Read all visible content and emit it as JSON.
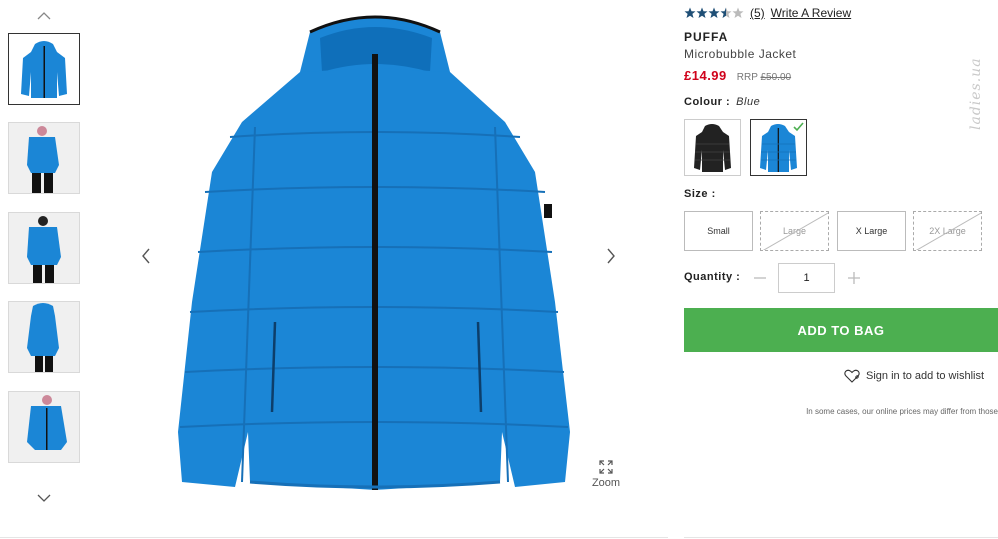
{
  "gallery": {
    "up_icon": "chevron-up-icon",
    "down_icon": "chevron-down-icon",
    "zoom_label": "Zoom"
  },
  "product": {
    "rating": 3.5,
    "review_count": "(5)",
    "write_review": "Write A Review",
    "brand": "PUFFA",
    "name": "Microbubble Jacket",
    "price": "£14.99",
    "rrp_label": "RRP",
    "rrp_value": "£50.00"
  },
  "colour": {
    "label": "Colour :",
    "selected": "Blue",
    "swatches": [
      "black",
      "blue"
    ]
  },
  "size": {
    "label": "Size :",
    "options": [
      {
        "label": "Small",
        "available": true
      },
      {
        "label": "Large",
        "available": false
      },
      {
        "label": "X Large",
        "available": true
      },
      {
        "label": "2X Large",
        "available": false
      }
    ]
  },
  "quantity": {
    "label": "Quantity :",
    "value": "1"
  },
  "actions": {
    "add_to_bag": "ADD TO BAG",
    "wishlist": "Sign in to add to wishlist",
    "note": "In some cases, our online prices may differ from those"
  },
  "colors": {
    "jacket": "#1b86d6",
    "accent_green": "#4caf50",
    "price_red": "#d0021b",
    "star": "#1f4f76"
  },
  "watermark": "ladies.ua"
}
